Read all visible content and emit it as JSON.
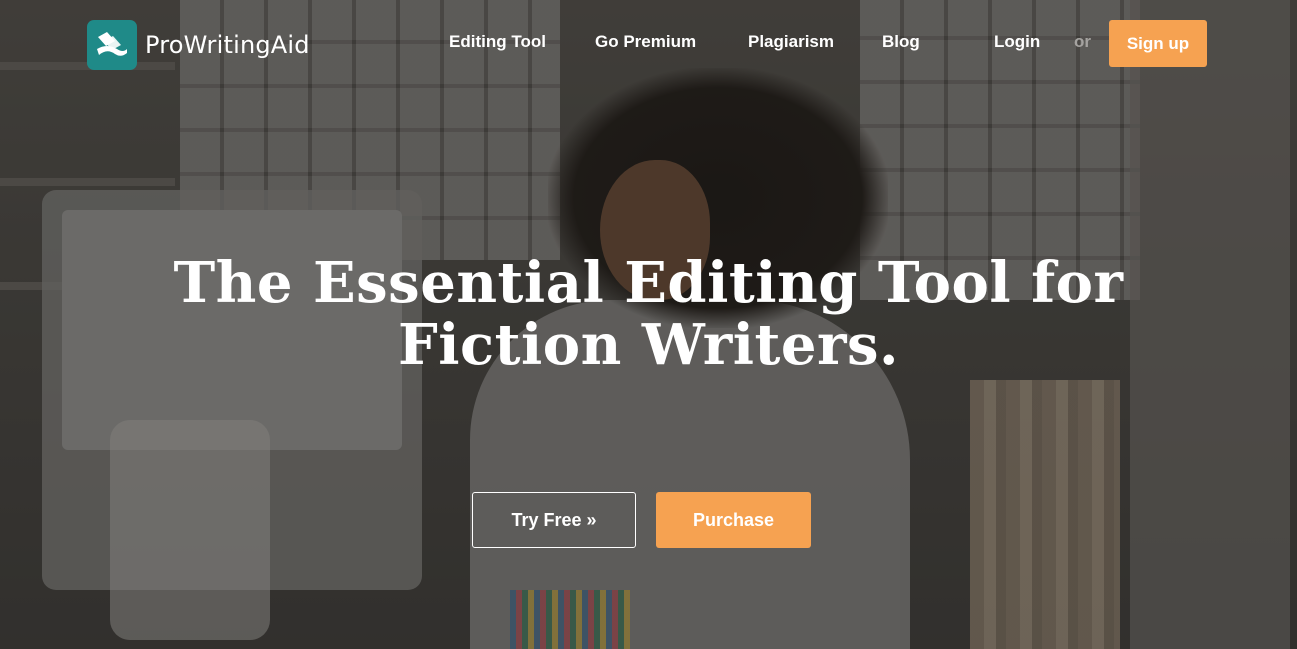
{
  "brand": {
    "name": "ProWritingAid",
    "logo_icon": "book-pages-icon",
    "accent_teal": "#1f8a88"
  },
  "nav": {
    "items": [
      {
        "label": "Editing Tool"
      },
      {
        "label": "Go Premium"
      },
      {
        "label": "Plagiarism"
      },
      {
        "label": "Blog"
      }
    ],
    "login": "Login",
    "or": "or",
    "signup": "Sign up"
  },
  "hero": {
    "headline_line1": "The Essential Editing Tool for",
    "headline_line2": "Fiction Writers.",
    "try_free": "Try Free »",
    "purchase": "Purchase"
  },
  "colors": {
    "cta_orange": "#f6a251",
    "text_white": "#ffffff",
    "muted_or": "#a5a3a0"
  }
}
